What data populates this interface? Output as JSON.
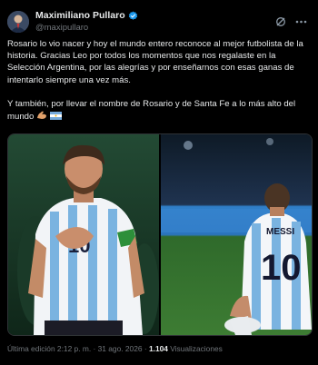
{
  "author": {
    "display_name": "Maximiliano Pullaro",
    "handle": "@maxipullaro"
  },
  "header": {
    "icons": [
      "grok-icon",
      "more-icon"
    ]
  },
  "tweet": {
    "paragraph_1": "Rosario lo vio nacer y hoy el mundo entero reconoce al mejor futbolista de la historia. Gracias Leo por todos los momentos que nos regalaste en la Selección Argentina, por las alegrías y por enseñarnos con esas ganas de intentarlo siempre una vez más.",
    "paragraph_2": "Y también, por llevar el nombre de Rosario y de Santa Fe a lo más alto del mundo",
    "emojis": [
      "flexed-biceps",
      "argentina-flag"
    ]
  },
  "media": {
    "photo_1": {
      "subject": "player-hand-on-chest",
      "shirt_number": "10"
    },
    "photo_2": {
      "name_on_shirt": "MESSI",
      "shirt_number": "10"
    }
  },
  "meta": {
    "edited_label": "Última edición 2:12 p. m. · 31 ago. 2026 ·",
    "views_count": "1.104",
    "views_label": "Visualizaciones"
  },
  "colors": {
    "background": "#000000",
    "text": "#e7e9ea",
    "muted": "#71767b",
    "verified": "#1d9bf0",
    "argentina_blue": "#75aadb"
  }
}
